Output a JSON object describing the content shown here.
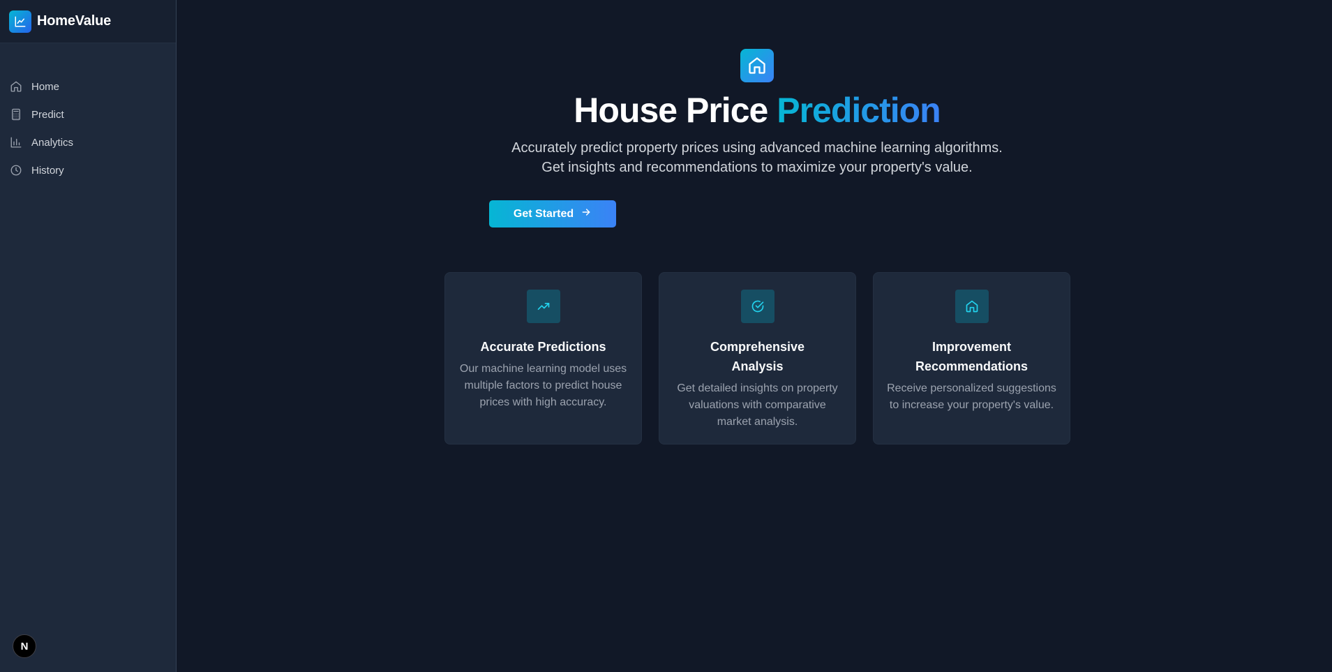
{
  "app": {
    "name": "HomeValue",
    "logo_icon": "chart-line-icon"
  },
  "sidebar": {
    "items": [
      {
        "label": "Home",
        "icon": "home-icon"
      },
      {
        "label": "Predict",
        "icon": "calculator-icon"
      },
      {
        "label": "Analytics",
        "icon": "bar-chart-icon"
      },
      {
        "label": "History",
        "icon": "clock-icon"
      }
    ],
    "dev_badge": "N"
  },
  "hero": {
    "icon": "house-icon",
    "title_part1": "House Price",
    "title_part2": "Prediction",
    "subtitle_line1": "Accurately predict property prices using advanced machine learning algorithms.",
    "subtitle_line2": "Get insights and recommendations to maximize your property's value.",
    "cta_label": "Get Started"
  },
  "features": [
    {
      "title": "Accurate Predictions",
      "description": "Our machine learning model uses multiple factors to predict house prices with high accuracy.",
      "icon": "trending-up-icon"
    },
    {
      "title": "Comprehensive Analysis",
      "description": "Get detailed insights on property valuations with comparative market analysis.",
      "icon": "check-circle-icon"
    },
    {
      "title": "Improvement Recommendations",
      "description": "Receive personalized suggestions to increase your property's value.",
      "icon": "home-icon"
    }
  ],
  "colors": {
    "background": "#111827",
    "sidebar": "#1e293b",
    "accent_start": "#06b6d4",
    "accent_end": "#3b82f6",
    "card": "#1e293b",
    "icon_tile": "#164e63"
  }
}
